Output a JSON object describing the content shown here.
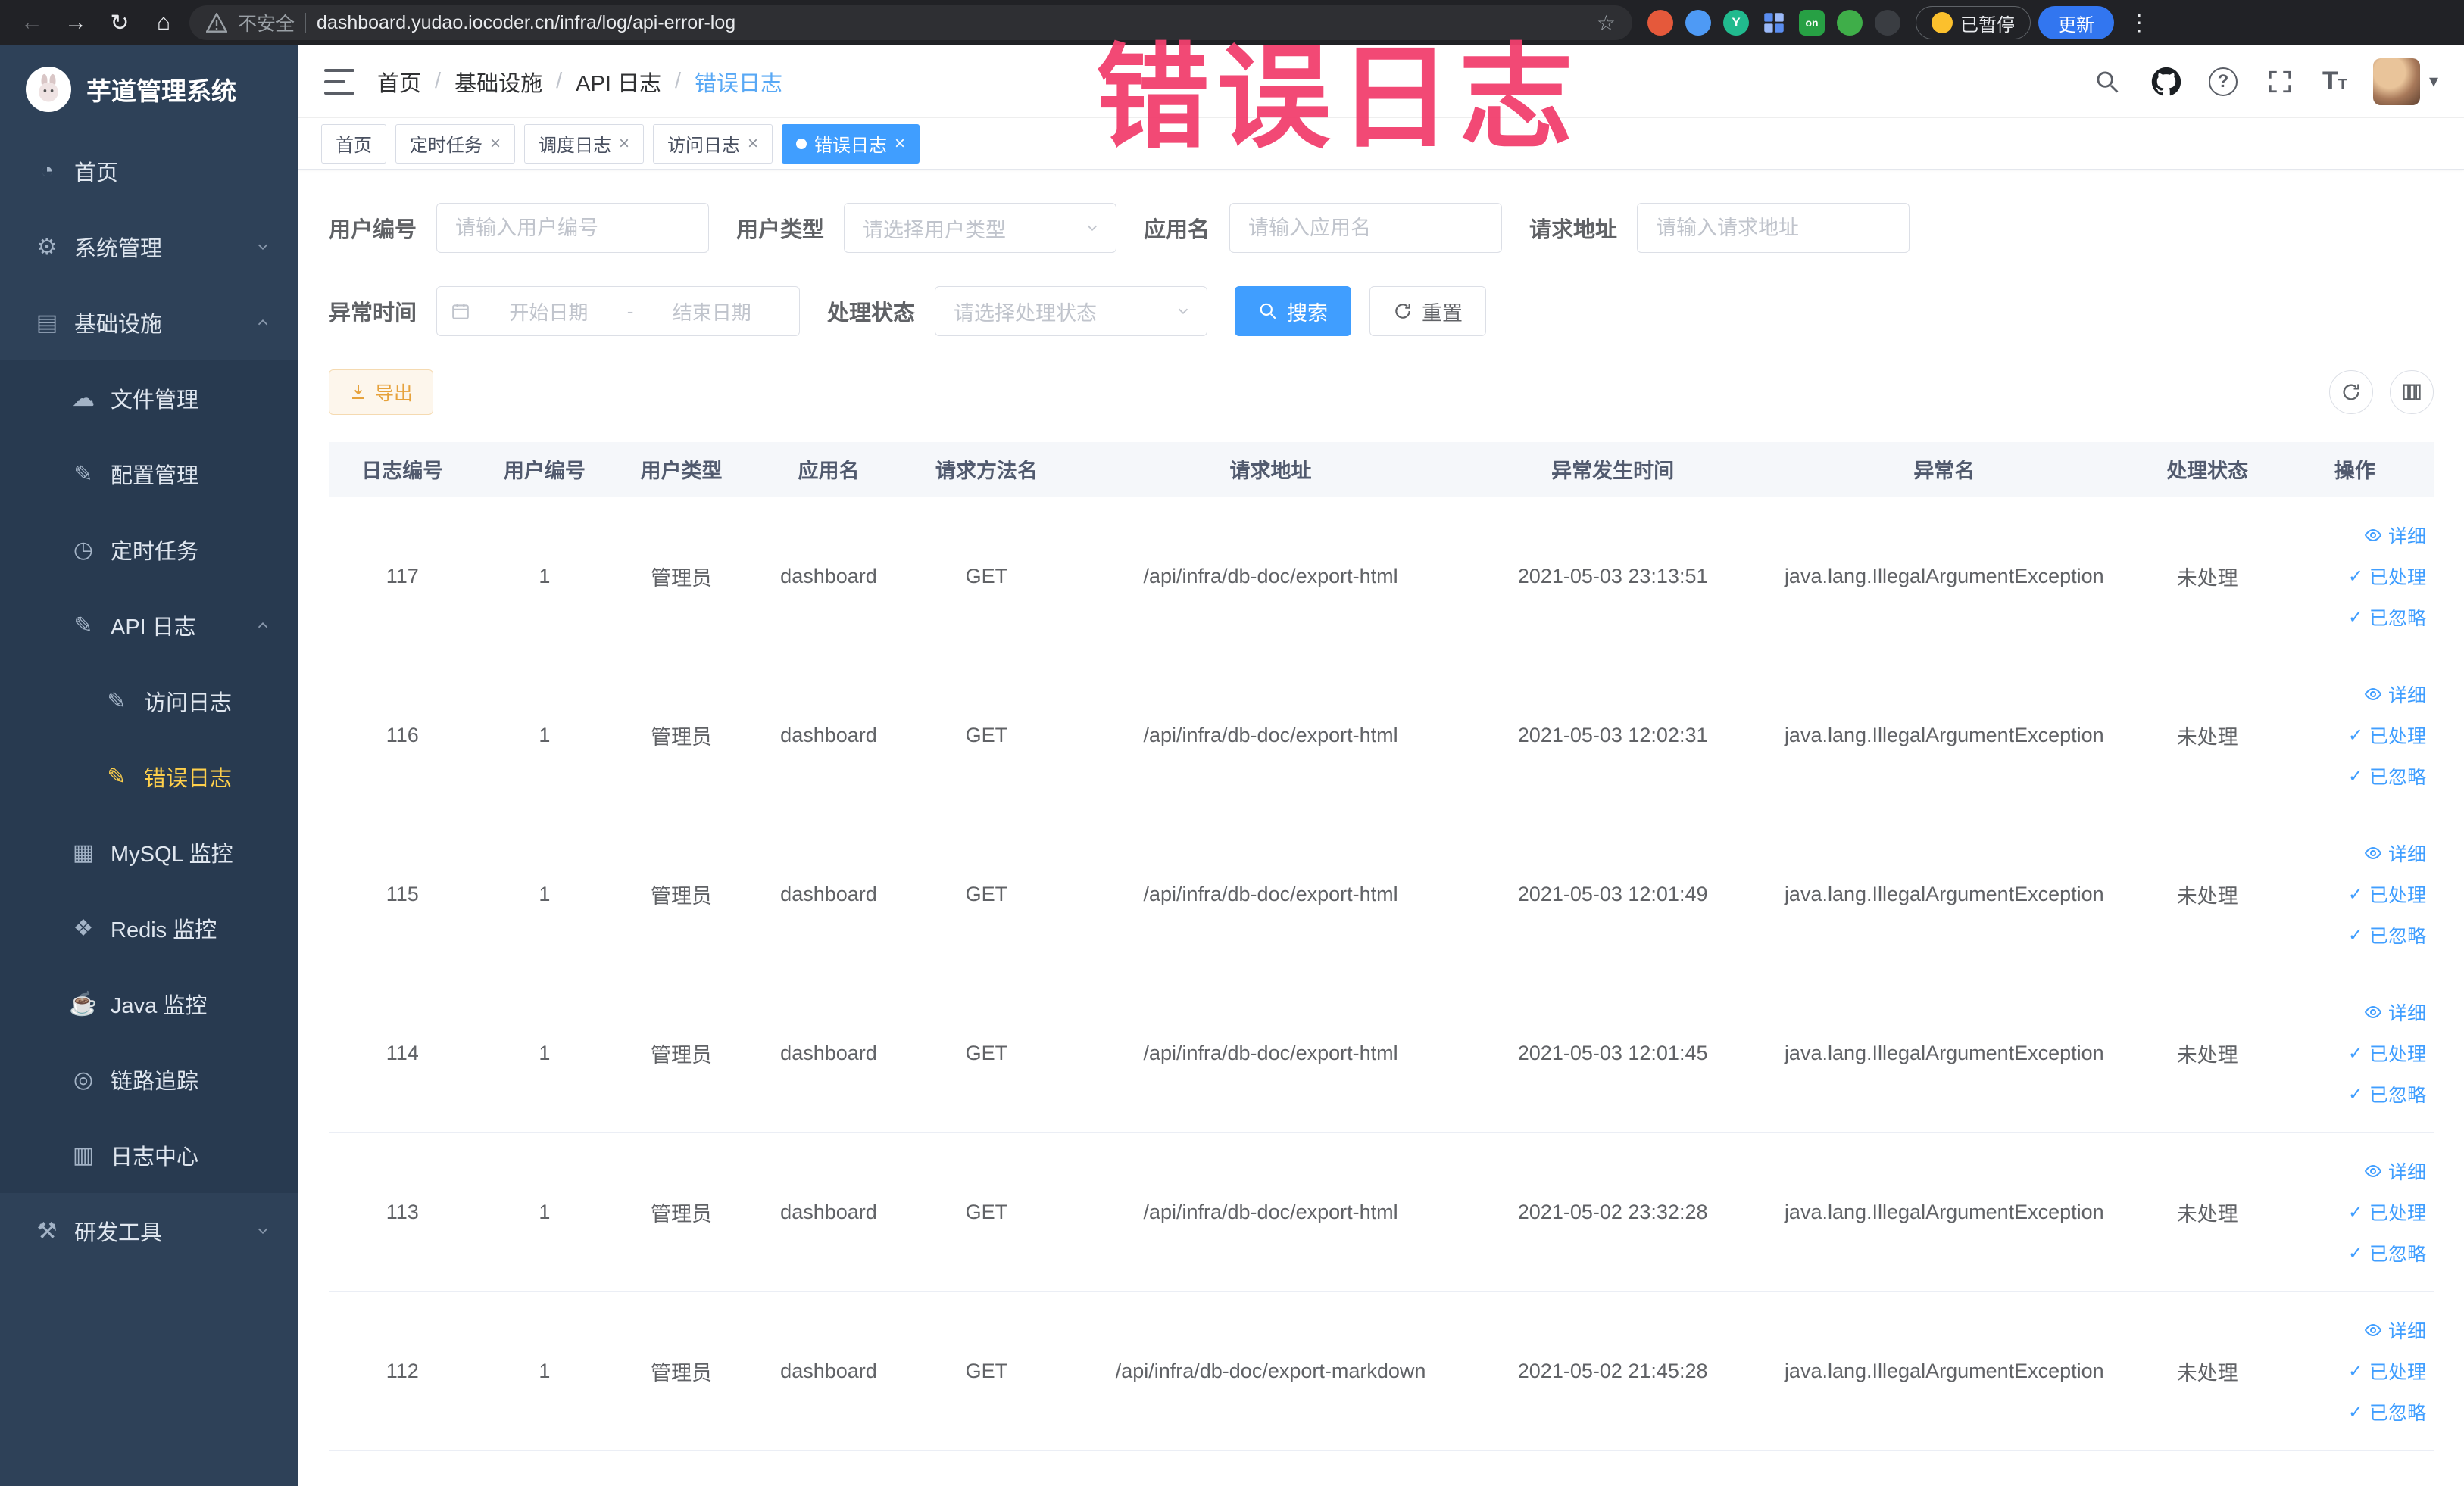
{
  "annotation": {
    "text": "错误日志"
  },
  "browser": {
    "security_label": "不安全",
    "url": "dashboard.yudao.iocoder.cn/infra/log/api-error-log",
    "paused_badge": "已暂停",
    "update_label": "更新",
    "extension_letter": "Y",
    "extension_on": "on"
  },
  "icons": {
    "back": "←",
    "forward": "→",
    "reload": "↻",
    "home": "⌂",
    "bookmark_star": "☆",
    "more_vertical": "⋮",
    "caret_down": "▾",
    "close": "×",
    "check": "✓",
    "help": "?",
    "menu_home": "◔",
    "menu_system": "⚙",
    "menu_infra": "▤",
    "menu_file": "☁",
    "menu_config": "✎",
    "menu_job": "◷",
    "menu_api_log": "✎",
    "menu_access_log": "✎",
    "menu_error_log": "✎",
    "menu_mysql": "▦",
    "menu_redis": "❖",
    "menu_java": "☕",
    "menu_tracing": "◎",
    "menu_log_center": "▥",
    "menu_dev_tools": "⚒"
  },
  "sidebar": {
    "logo_title": "芋道管理系统",
    "items": {
      "home": "首页",
      "system": "系统管理",
      "infra": "基础设施",
      "file": "文件管理",
      "config": "配置管理",
      "job": "定时任务",
      "api_log": "API 日志",
      "access_log": "访问日志",
      "error_log": "错误日志",
      "mysql": "MySQL 监控",
      "redis": "Redis 监控",
      "java": "Java 监控",
      "tracing": "链路追踪",
      "log_center": "日志中心",
      "dev_tools": "研发工具"
    }
  },
  "header": {
    "breadcrumb": [
      "首页",
      "基础设施",
      "API 日志",
      "错误日志"
    ],
    "breadcrumb_separator": "/"
  },
  "tabs": {
    "home": "首页",
    "job": "定时任务",
    "job_log": "调度日志",
    "access_log": "访问日志",
    "error_log": "错误日志"
  },
  "filters": {
    "user_id_label": "用户编号",
    "user_id_placeholder": "请输入用户编号",
    "user_type_label": "用户类型",
    "user_type_placeholder": "请选择用户类型",
    "app_name_label": "应用名",
    "app_name_placeholder": "请输入应用名",
    "request_url_label": "请求地址",
    "request_url_placeholder": "请输入请求地址",
    "exception_time_label": "异常时间",
    "date_start_placeholder": "开始日期",
    "date_separator": "-",
    "date_end_placeholder": "结束日期",
    "process_status_label": "处理状态",
    "process_status_placeholder": "请选择处理状态",
    "search_label": "搜索",
    "reset_label": "重置"
  },
  "toolbar": {
    "export_label": "导出"
  },
  "table": {
    "columns": [
      "日志编号",
      "用户编号",
      "用户类型",
      "应用名",
      "请求方法名",
      "请求地址",
      "异常发生时间",
      "异常名",
      "处理状态",
      "操作"
    ],
    "row_actions": {
      "detail": "详细",
      "processed": "已处理",
      "ignored": "已忽略"
    },
    "rows": [
      {
        "log_id": "117",
        "user_id": "1",
        "user_type": "管理员",
        "app_name": "dashboard",
        "method": "GET",
        "url": "/api/infra/db-doc/export-html",
        "time": "2021-05-03 23:13:51",
        "exception": "java.lang.IllegalArgumentException",
        "status": "未处理"
      },
      {
        "log_id": "116",
        "user_id": "1",
        "user_type": "管理员",
        "app_name": "dashboard",
        "method": "GET",
        "url": "/api/infra/db-doc/export-html",
        "time": "2021-05-03 12:02:31",
        "exception": "java.lang.IllegalArgumentException",
        "status": "未处理"
      },
      {
        "log_id": "115",
        "user_id": "1",
        "user_type": "管理员",
        "app_name": "dashboard",
        "method": "GET",
        "url": "/api/infra/db-doc/export-html",
        "time": "2021-05-03 12:01:49",
        "exception": "java.lang.IllegalArgumentException",
        "status": "未处理"
      },
      {
        "log_id": "114",
        "user_id": "1",
        "user_type": "管理员",
        "app_name": "dashboard",
        "method": "GET",
        "url": "/api/infra/db-doc/export-html",
        "time": "2021-05-03 12:01:45",
        "exception": "java.lang.IllegalArgumentException",
        "status": "未处理"
      },
      {
        "log_id": "113",
        "user_id": "1",
        "user_type": "管理员",
        "app_name": "dashboard",
        "method": "GET",
        "url": "/api/infra/db-doc/export-html",
        "time": "2021-05-02 23:32:28",
        "exception": "java.lang.IllegalArgumentException",
        "status": "未处理"
      },
      {
        "log_id": "112",
        "user_id": "1",
        "user_type": "管理员",
        "app_name": "dashboard",
        "method": "GET",
        "url": "/api/infra/db-doc/export-markdown",
        "time": "2021-05-02 21:45:28",
        "exception": "java.lang.IllegalArgumentException",
        "status": "未处理"
      }
    ]
  }
}
